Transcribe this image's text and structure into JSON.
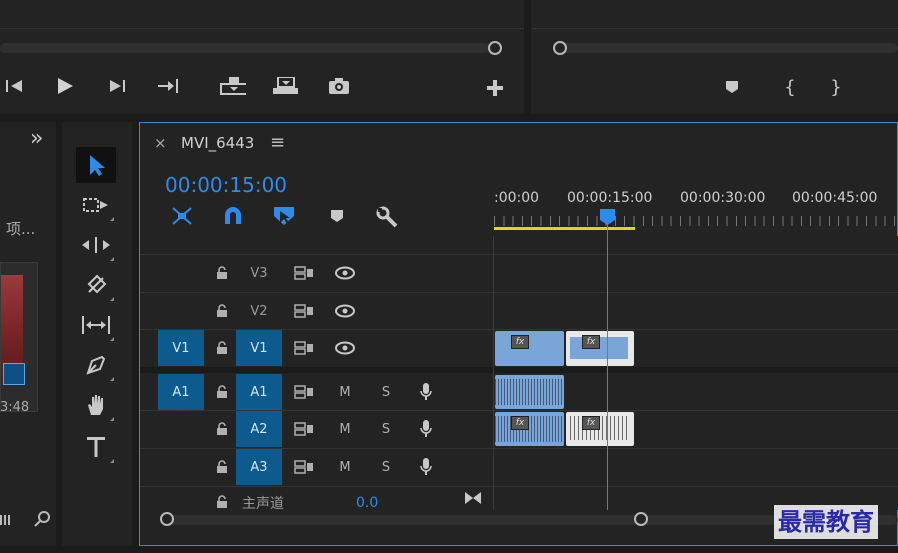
{
  "source_monitor": {
    "controls": [
      "step-back-icon",
      "play-icon",
      "step-forward-icon",
      "go-to-out-icon",
      "insert-icon",
      "overwrite-icon",
      "export-frame-icon",
      "add-button-icon"
    ]
  },
  "program_monitor": {
    "controls": [
      "marker-icon",
      "mark-in-icon",
      "mark-out-icon"
    ]
  },
  "project_panel": {
    "label": "项...",
    "duration": "3:48",
    "collapse_glyph": "»"
  },
  "timeline": {
    "close_glyph": "×",
    "sequence_name": "MVI_6443",
    "menu_glyph": "≡",
    "timecode": "00:00:15:00",
    "ruler_labels": [
      ":00:00",
      "00:00:15:00",
      "00:00:30:00",
      "00:00:45:00"
    ],
    "tracks": {
      "v3": {
        "name": "V3"
      },
      "v2": {
        "name": "V2"
      },
      "v1": {
        "source": "V1",
        "name": "V1"
      },
      "a1": {
        "source": "A1",
        "name": "A1",
        "m": "M",
        "s": "S"
      },
      "a2": {
        "name": "A2",
        "m": "M",
        "s": "S"
      },
      "a3": {
        "name": "A3",
        "m": "M",
        "s": "S"
      },
      "master": {
        "name": "主声道",
        "value": "0.0"
      }
    },
    "fx_label": "fx"
  },
  "watermark": "最需教育",
  "colors": {
    "accent": "#2d8ceb",
    "selected_track": "#0d5a8f",
    "clip_video": "#7aa5d9",
    "clip_audio": "#7aa5d9",
    "work_area": "#e8d313"
  }
}
